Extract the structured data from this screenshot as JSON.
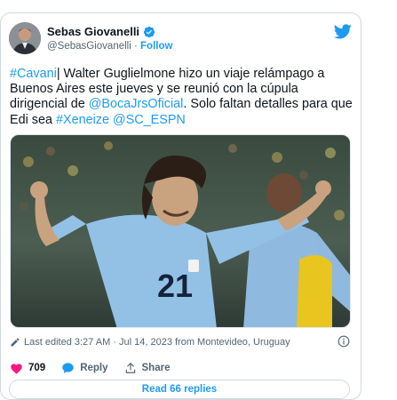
{
  "author": {
    "name": "Sebas Giovanelli",
    "handle": "@SebasGiovanelli",
    "separator": "·",
    "follow_label": "Follow"
  },
  "tweet": {
    "parts": [
      {
        "text": "#Cavani",
        "link": true
      },
      {
        "text": "| Walter Guglielmone hizo un viaje relámpago a Buenos Aires este jueves y se reunió con la cúpula dirigencial de ",
        "link": false
      },
      {
        "text": "@BocaJrsOficial",
        "link": true
      },
      {
        "text": ". Solo faltan detalles para que Edi sea ",
        "link": false
      },
      {
        "text": "#Xeneize",
        "link": true
      },
      {
        "text": " ",
        "link": false
      },
      {
        "text": "@SC_ESPN",
        "link": true
      }
    ]
  },
  "photo": {
    "jersey_number": "21"
  },
  "meta": {
    "edited_text": "Last edited 3:27 AM · Jul 14, 2023 from Montevideo, Uruguay"
  },
  "actions": {
    "likes": "709",
    "reply_label": "Reply",
    "share_label": "Share"
  },
  "read_replies_label": "Read 66 replies",
  "colors": {
    "accent": "#1d9bf0",
    "like": "#f91880",
    "text": "#0f1419",
    "muted": "#536471"
  }
}
